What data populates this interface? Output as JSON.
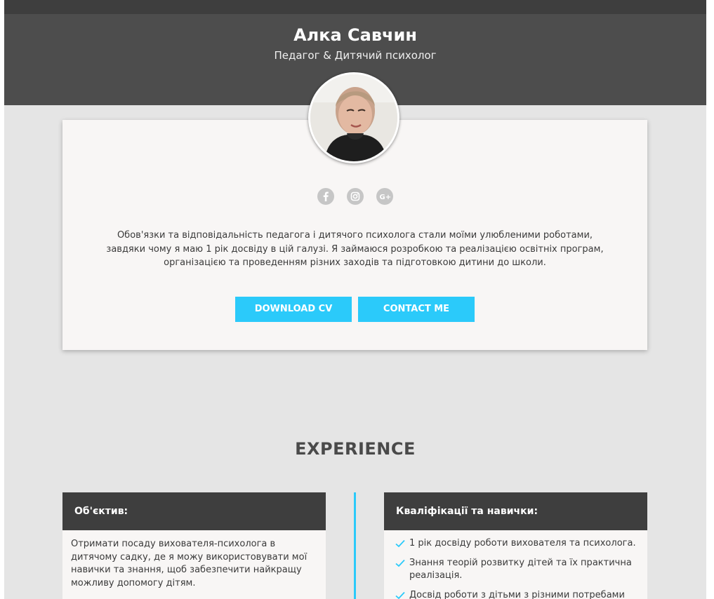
{
  "header": {
    "name": "Алка Савчин",
    "role": "Педагог & Дитячий психолог"
  },
  "profile": {
    "socials": [
      {
        "name": "facebook-icon"
      },
      {
        "name": "instagram-icon"
      },
      {
        "name": "google-plus-icon"
      }
    ],
    "bio_lines": [
      "Обов'язки та відповідальність педагога і дитячого психолога стали моїми улюбленими роботами,",
      "завдяки чому я маю 1 рік досвіду в цій галузі. Я займаюся розробкою та реалізацією освітніх програм,",
      "організацією та проведенням різних заходів та підготовкою дитини до школи."
    ],
    "buttons": {
      "download_cv": "DOWNLOAD CV",
      "contact_me": "CONTACT ME"
    }
  },
  "experience": {
    "title": "EXPERIENCE",
    "objective": {
      "heading": "Об'єктив:",
      "text": "Отримати посаду вихователя-психолога в дитячому садку, де я можу використовувати мої навички та знання, щоб забезпечити найкращу можливу допомогу дітям."
    },
    "qualifications": {
      "heading": "Кваліфікації та навички:",
      "items": [
        "1 рік досвіду роботи вихователя та психолога.",
        "Знання теорій розвитку дітей та їх практична реалізація.",
        "Досвід роботи з дітьми з різними потребами"
      ]
    }
  },
  "colors": {
    "accent": "#2bcafa",
    "header_bg": "#4d4d4d",
    "page_bg": "#e5e5e5",
    "card_bg": "#f8f6f5"
  }
}
